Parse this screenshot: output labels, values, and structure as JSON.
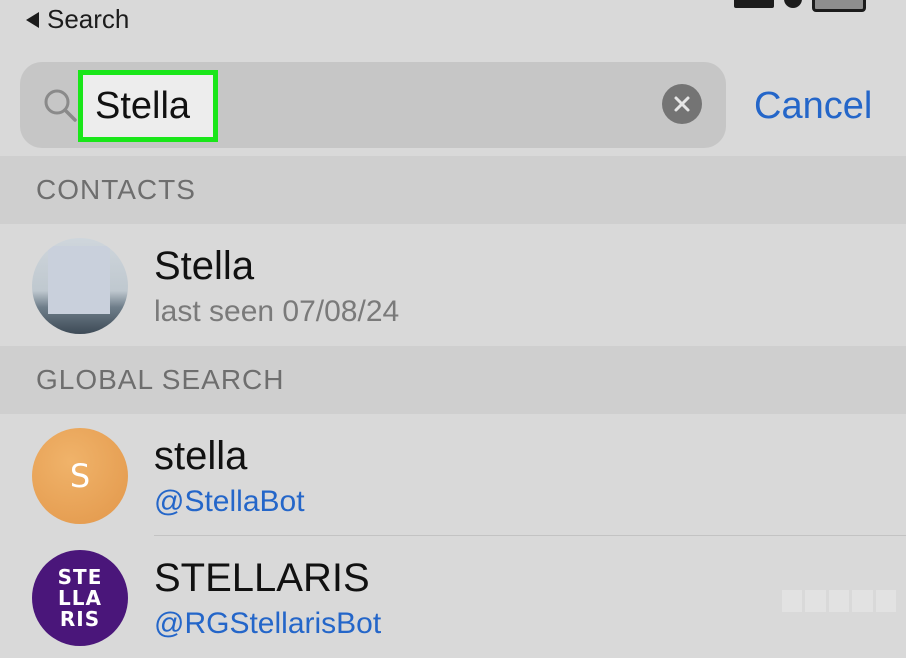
{
  "status_bar": {
    "back_label": "Search"
  },
  "search": {
    "query": "Stella",
    "cancel_label": "Cancel"
  },
  "sections": {
    "contacts": "CONTACTS",
    "global_search": "GLOBAL SEARCH"
  },
  "contacts": [
    {
      "name": "Stella",
      "subtitle": "last seen 07/08/24"
    }
  ],
  "global_results": [
    {
      "name": "stella",
      "username": "@StellaBot",
      "avatar_letter": "S"
    },
    {
      "name": "STELLARIS",
      "username": "@RGStellarisBot",
      "avatar_text": [
        "STE",
        "LLA",
        "RIS"
      ]
    }
  ],
  "colors": {
    "accent": "#2466c9",
    "highlight": "#19e619"
  }
}
